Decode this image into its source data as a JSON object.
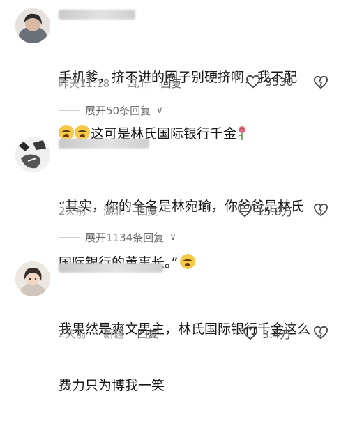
{
  "comments": [
    {
      "text_line1": "手机爹，挤不进的圈子别硬挤啊，我不配",
      "text_line2": "这可是林氏国际银行千金",
      "time": "昨天11:18",
      "sep": "·",
      "location": "四川",
      "reply_label": "回复",
      "likes": "3530",
      "expand_label": "展开50条回复"
    },
    {
      "text_line1": "“其实，你的全名是林宛瑜，你爸爸是林氏",
      "text_line2": "国际银行的董事长。”",
      "time": "2天前",
      "sep": "·",
      "location": "湖北",
      "reply_label": "回复",
      "likes": "15.8万",
      "expand_label": "展开1134条回复"
    },
    {
      "text_line1": "我果然是爽文男主，林氏国际银行千金这么",
      "text_line2": "费力只为博我一笑",
      "time": "2天前",
      "sep": "·",
      "location": "新疆",
      "reply_label": "回复",
      "likes": "3.4万"
    }
  ],
  "icons": {
    "like": "heart-outline-icon",
    "dislike": "broken-heart-icon",
    "crying_emoji": "crying-face-emoji-icon",
    "rose": "rose-icon",
    "expand": "chevron-down-icon"
  },
  "colors": {
    "text": "#161616",
    "meta": "#8f8f8f",
    "accent_text": "#4a4a4a"
  }
}
